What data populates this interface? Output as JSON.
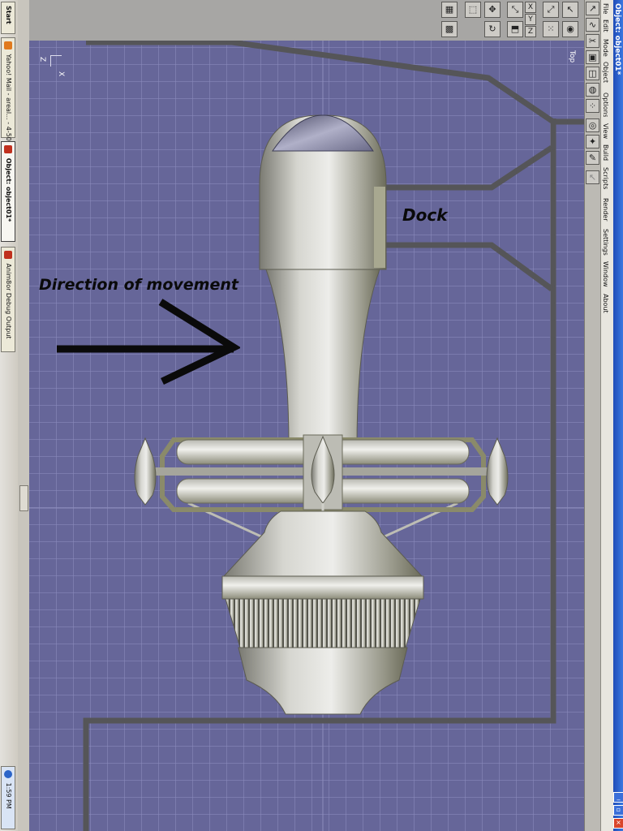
{
  "taskbar": {
    "start_label": "Start",
    "tasks": [
      {
        "label": "Yahoo! Mail - areal... - 4-50...",
        "icon": "firefox-icon"
      },
      {
        "label": "Object: object01*",
        "icon": "anim8or-icon"
      },
      {
        "label": "Anim8or Debug Output",
        "icon": "anim8or-icon"
      }
    ],
    "clock": "1:59 PM"
  },
  "window": {
    "title": "Object: object01*"
  },
  "menu": {
    "items": [
      "File",
      "Edit",
      "Mode",
      "Object",
      "Options",
      "View",
      "Build",
      "Scripts",
      "Render",
      "Settings",
      "Window",
      "About"
    ]
  },
  "viewport": {
    "view_label": "Top",
    "axis_z": "Z",
    "axis_x": "X",
    "annotation_direction": "Direction of movement",
    "annotation_dock": "Dock"
  },
  "toolbar": {
    "axis_labels": [
      "X",
      "Y",
      "Z"
    ]
  }
}
